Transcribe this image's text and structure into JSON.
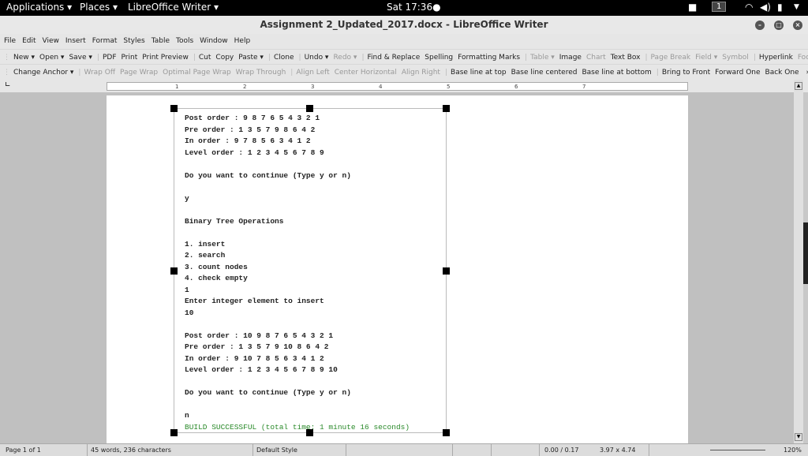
{
  "topbar": {
    "applications": "Applications ▾",
    "places": "Places ▾",
    "app": "LibreOffice Writer ▾",
    "clock": "Sat 17:36●",
    "workspace": "1"
  },
  "window": {
    "title": "Assignment 2_Updated_2017.docx - LibreOffice Writer"
  },
  "menu": [
    "File",
    "Edit",
    "View",
    "Insert",
    "Format",
    "Styles",
    "Table",
    "Tools",
    "Window",
    "Help"
  ],
  "toolbar1": [
    {
      "l": "New ▾"
    },
    {
      "l": "Open ▾"
    },
    {
      "l": "Save ▾"
    },
    {
      "sep": true
    },
    {
      "l": "PDF"
    },
    {
      "l": "Print"
    },
    {
      "l": "Print Preview"
    },
    {
      "sep": true
    },
    {
      "l": "Cut"
    },
    {
      "l": "Copy"
    },
    {
      "l": "Paste ▾"
    },
    {
      "sep": true
    },
    {
      "l": "Clone"
    },
    {
      "sep": true
    },
    {
      "l": "Undo ▾"
    },
    {
      "l": "Redo ▾",
      "d": true
    },
    {
      "sep": true
    },
    {
      "l": "Find & Replace"
    },
    {
      "l": "Spelling"
    },
    {
      "l": "Formatting Marks"
    },
    {
      "sep": true
    },
    {
      "l": "Table ▾",
      "d": true
    },
    {
      "l": "Image"
    },
    {
      "l": "Chart",
      "d": true
    },
    {
      "l": "Text Box"
    },
    {
      "sep": true
    },
    {
      "l": "Page Break",
      "d": true
    },
    {
      "l": "Field ▾",
      "d": true
    },
    {
      "l": "Symbol",
      "d": true
    },
    {
      "sep": true
    },
    {
      "l": "Hyperlink"
    },
    {
      "l": "Footnote",
      "d": true
    },
    {
      "l": "»"
    }
  ],
  "toolbar2": [
    {
      "l": "Change Anchor ▾"
    },
    {
      "sep": true
    },
    {
      "l": "Wrap Off",
      "d": true
    },
    {
      "l": "Page Wrap",
      "d": true
    },
    {
      "l": "Optimal Page Wrap",
      "d": true
    },
    {
      "l": "Wrap Through",
      "d": true
    },
    {
      "sep": true
    },
    {
      "l": "Align Left",
      "d": true
    },
    {
      "l": "Center Horizontal",
      "d": true
    },
    {
      "l": "Align Right",
      "d": true
    },
    {
      "sep": true
    },
    {
      "l": "Base line at top"
    },
    {
      "l": "Base line centered"
    },
    {
      "l": "Base line at bottom"
    },
    {
      "sep": true
    },
    {
      "l": "Bring to Front"
    },
    {
      "l": "Forward One"
    },
    {
      "l": "Back One"
    },
    {
      "l": "   »"
    }
  ],
  "ruler": {
    "ticks": [
      "1",
      "2",
      "3",
      "4",
      "5",
      "6",
      "7"
    ]
  },
  "document": {
    "lines": [
      "Post order : 9 8 7 6 5 4 3 2 1",
      "Pre order : 1 3 5 7 9 8 6 4 2",
      "In order : 9 7 8 5 6 3 4 1 2",
      "Level order : 1 2 3 4 5 6 7 8 9",
      "",
      "Do you want to continue (Type y or n)",
      "",
      "y",
      "",
      "Binary Tree Operations",
      "",
      "1. insert",
      "2. search",
      "3. count nodes",
      "4. check empty",
      "1",
      "Enter integer element to insert",
      "10",
      "",
      "Post order : 10 9 8 7 6 5 4 3 2 1",
      "Pre order : 1 3 5 7 9 10 8 6 4 2",
      "In order : 9 10 7 8 5 6 3 4 1 2",
      "Level order : 1 2 3 4 5 6 7 8 9 10",
      "",
      "Do you want to continue (Type y or n)",
      "",
      "n"
    ],
    "build": "BUILD SUCCESSFUL (total time: 1 minute 16 seconds)"
  },
  "status": {
    "page": "Page 1 of 1",
    "words": "45 words, 236 characters",
    "style": "Default Style",
    "pos": "0.00 / 0.17",
    "size": "3.97 x 4.74",
    "zoom": "120%"
  }
}
